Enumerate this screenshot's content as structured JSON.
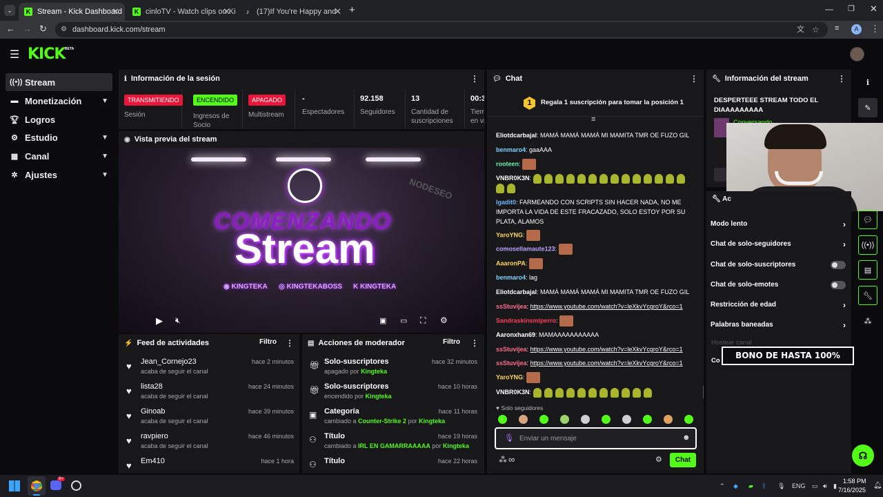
{
  "browser": {
    "tabs": [
      {
        "title": "Stream - Kick Dashboard",
        "active": true
      },
      {
        "title": "cinloTV - Watch clips on Kick",
        "active": false
      },
      {
        "title": "(17)If You're Happy and You Kn",
        "active": false
      }
    ],
    "url": "dashboard.kick.com/stream",
    "profile_initial": "A"
  },
  "header": {
    "logo": "KICK",
    "logo_badge": "BETA"
  },
  "sidebar": {
    "items": [
      {
        "label": "Stream",
        "icon": "broadcast-icon",
        "active": true
      },
      {
        "label": "Monetización",
        "icon": "money-icon",
        "chevron": true
      },
      {
        "label": "Logros",
        "icon": "trophy-icon"
      },
      {
        "label": "Estudio",
        "icon": "gear-icon",
        "chevron": true
      },
      {
        "label": "Canal",
        "icon": "grid-icon",
        "chevron": true
      },
      {
        "label": "Ajustes",
        "icon": "settings-icon",
        "chevron": true
      }
    ]
  },
  "session": {
    "title": "Información de la sesión",
    "stats": [
      {
        "badge": "TRANSMITIENDO",
        "badge_color": "#e8163b",
        "label": "Sesión"
      },
      {
        "badge": "ENCENDIDO",
        "badge_color": "#53fc18",
        "label": "Ingresos de Socio"
      },
      {
        "badge": "APAGADO",
        "badge_color": "#e8163b",
        "label": "Multistream"
      },
      {
        "value": "-",
        "label": "Espectadores"
      },
      {
        "value": "92.158",
        "label": "Seguidores"
      },
      {
        "value": "13",
        "label": "Cantidad de suscripciones"
      },
      {
        "value": "00:3",
        "label": "Tiem en vi"
      }
    ]
  },
  "preview": {
    "title": "Vista previa del stream",
    "overlay_top": "COMENZANDO",
    "overlay_main": "Stream",
    "wall_text": "NODESEO",
    "socials": [
      "KINGTEKA",
      "KINGTEKABOSS",
      "KINGTEKA"
    ]
  },
  "feed": {
    "title": "Feed de actividades",
    "filter_label": "Filtro",
    "items": [
      {
        "name": "Jean_Cornejo23",
        "sub": "acaba de seguir el canal",
        "time": "hace 2 minutos"
      },
      {
        "name": "lista28",
        "sub": "acaba de seguir el canal",
        "time": "hace 24 minutos"
      },
      {
        "name": "Ginoab",
        "sub": "acaba de seguir el canal",
        "time": "hace 39 minutos"
      },
      {
        "name": "ravpiero",
        "sub": "acaba de seguir el canal",
        "time": "hace 46 minutos"
      },
      {
        "name": "Em410",
        "sub": "",
        "time": "hace 1 hora"
      }
    ]
  },
  "mod": {
    "title": "Acciones de moderador",
    "filter_label": "Filtro",
    "items": [
      {
        "name": "Solo-suscriptores",
        "pre": "apagado por",
        "hl": "Kingteka",
        "mid": "",
        "hl2": "",
        "time": "hace 32 minutos",
        "icon": "gift-icon"
      },
      {
        "name": "Solo-suscriptores",
        "pre": "encendido por",
        "hl": "Kingteka",
        "mid": "",
        "hl2": "",
        "time": "hace 10 horas",
        "icon": "gift-icon"
      },
      {
        "name": "Categoría",
        "pre": "cambiado a",
        "hl": "Counter-Strike 2",
        "mid": "por",
        "hl2": "Kingteka",
        "time": "hace 11 horas",
        "icon": "category-icon"
      },
      {
        "name": "Título",
        "pre": "cambiado a",
        "hl": "IRL EN GAMARRAAAAA",
        "mid": "por",
        "hl2": "Kingteka",
        "time": "hace 19 horas",
        "icon": "title-icon"
      },
      {
        "name": "Título",
        "pre": "",
        "hl": "",
        "mid": "",
        "hl2": "",
        "time": "hace 22 horas",
        "icon": "title-icon"
      }
    ]
  },
  "chat": {
    "title": "Chat",
    "pinned_rank": "1",
    "pinned_text": "Regala 1 suscripción para tomar la posición 1",
    "messages": [
      {
        "user": "Eliotdcarbajal",
        "color": "#ffffff",
        "text": "MAMÁ MAMÁ MAMÁ MI MAMITA TMR OE FUZO GIL"
      },
      {
        "user": "benmaro4",
        "color": "#7fd1ff",
        "text": "gaaAAA"
      },
      {
        "user": "rooteen",
        "color": "#6ef0b0",
        "text": "",
        "emote": "face"
      },
      {
        "user": "VNBR0K3N",
        "color": "#ffffff",
        "text": "",
        "emote": "corn16"
      },
      {
        "user": "lgadit0",
        "color": "#6fb5ff",
        "text": "FARMEANDO CON SCRIPTS SIN HACER NADA, NO ME IMPORTA LA VIDA DE ESTE FRACAZADO, SOLO ESTOY POR SU PLATA, ALAMOS"
      },
      {
        "user": "YaroYNG",
        "color": "#ffd65c",
        "text": "",
        "emote": "face"
      },
      {
        "user": "comosellamaute123",
        "color": "#b9a2ff",
        "text": "",
        "emote": "face"
      },
      {
        "user": "AaaronPA",
        "color": "#ffd65c",
        "text": "",
        "emote": "face"
      },
      {
        "user": "benmaro4",
        "color": "#7fd1ff",
        "text": "lag"
      },
      {
        "user": "Eliotdcarbajal",
        "color": "#ffffff",
        "text": "MAMÁ MAMÁ MAMÁ MI MAMITA TMR OE FUZO GIL"
      },
      {
        "user": "ssStuvijea",
        "color": "#ff6b8b",
        "link": "https://www.youtube.com/watch?v=leXkvYcgroY&rco=1"
      },
      {
        "user": "Sandraskinsmiperro",
        "color": "#ff3b5c",
        "text": "",
        "emote": "face"
      },
      {
        "user": "Aaronxhan69",
        "color": "#ffffff",
        "text": "MAMAAAAAAAAAAA"
      },
      {
        "user": "ssStuvijea",
        "color": "#ff6b8b",
        "link": "https://www.youtube.com/watch?v=leXkvYcgroY&rco=1"
      },
      {
        "user": "ssStuvijea",
        "color": "#ff6b8b",
        "link": "https://www.youtube.com/watch?v=leXkvYcgroY&rco=1"
      },
      {
        "user": "YaroYNG",
        "color": "#ffd65c",
        "text": "",
        "emote": "face"
      },
      {
        "user": "VNBR0K3N",
        "color": "#ffffff",
        "text": "",
        "emote": "corn11"
      }
    ],
    "mode_label": "Solo seguidores",
    "input_placeholder": "Enviar un mensaje",
    "send_label": "Chat"
  },
  "stream_info": {
    "title": "Información del stream",
    "stream_title": "DESPERTEEE STREAM TODO EL DIAAAAAAAAA",
    "category": "Conversando",
    "section_label": "Ac",
    "options": [
      {
        "label": "Modo lento",
        "type": "arrow"
      },
      {
        "label": "Chat de solo-seguidores",
        "type": "arrow"
      },
      {
        "label": "Chat de solo-suscriptores",
        "type": "toggle"
      },
      {
        "label": "Chat de solo-emotes",
        "type": "toggle"
      },
      {
        "label": "Restricción de edad",
        "type": "arrow"
      },
      {
        "label": "Palabras baneadas",
        "type": "arrow"
      }
    ],
    "faded_option": "Hostear canal",
    "cut_option": "Co",
    "promo": "BONO DE HASTA 100%"
  },
  "taskbar": {
    "lang": "ENG",
    "time": "1:58 PM",
    "date": "7/16/2025",
    "discord_badge": "9+"
  },
  "colors": {
    "accent": "#53fc18",
    "live": "#e8163b",
    "panel": "#18181b",
    "bg": "#0b0b0d"
  }
}
